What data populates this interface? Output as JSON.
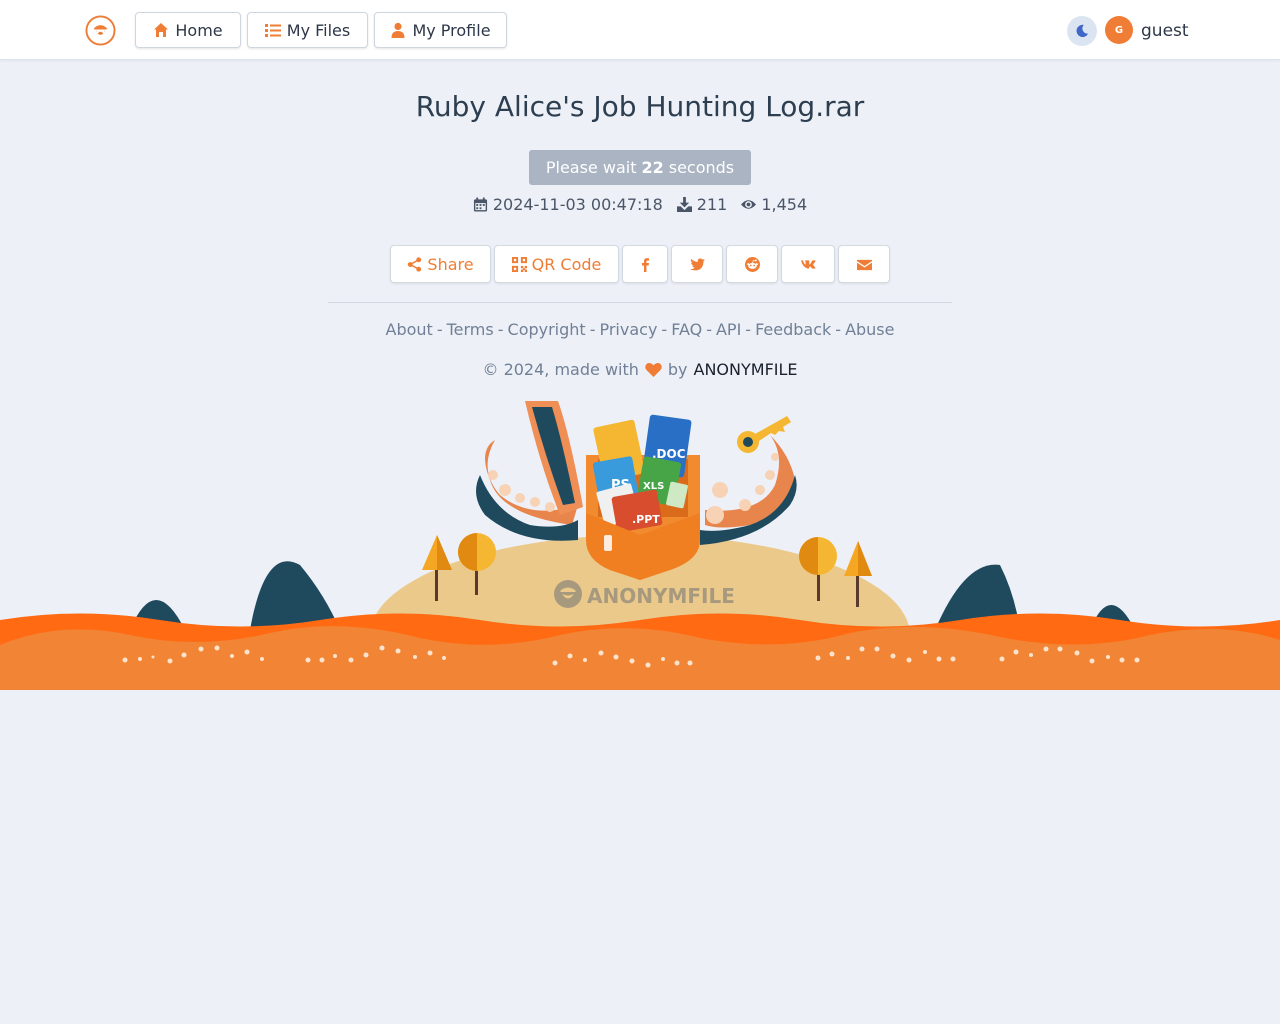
{
  "nav": {
    "home_label": "Home",
    "files_label": "My Files",
    "profile_label": "My Profile",
    "avatar_initial": "G",
    "username": "guest"
  },
  "file": {
    "title": "Ruby Alice's Job Hunting Log.rar",
    "wait_prefix": "Please wait",
    "wait_seconds": "22",
    "wait_suffix": "seconds",
    "uploaded": "2024-11-03 00:47:18",
    "downloads": "211",
    "views": "1,454"
  },
  "share": {
    "share_label": "Share",
    "qr_label": "QR Code"
  },
  "footer": {
    "links": [
      "About",
      "Terms",
      "Copyright",
      "Privacy",
      "FAQ",
      "API",
      "Feedback",
      "Abuse"
    ],
    "copyright_prefix": "© 2024, made with",
    "copyright_by": "by",
    "brand": "ANONYMFILE"
  },
  "illustration": {
    "doc_label": ".DOC",
    "xls_label": "XLS",
    "ps_label": "PS",
    "ppt_label": ".PPT",
    "brand": "ANONYMFILE"
  },
  "colors": {
    "accent": "#ef7d35",
    "background": "#edf1f7",
    "wait_button": "#aab4c2"
  }
}
